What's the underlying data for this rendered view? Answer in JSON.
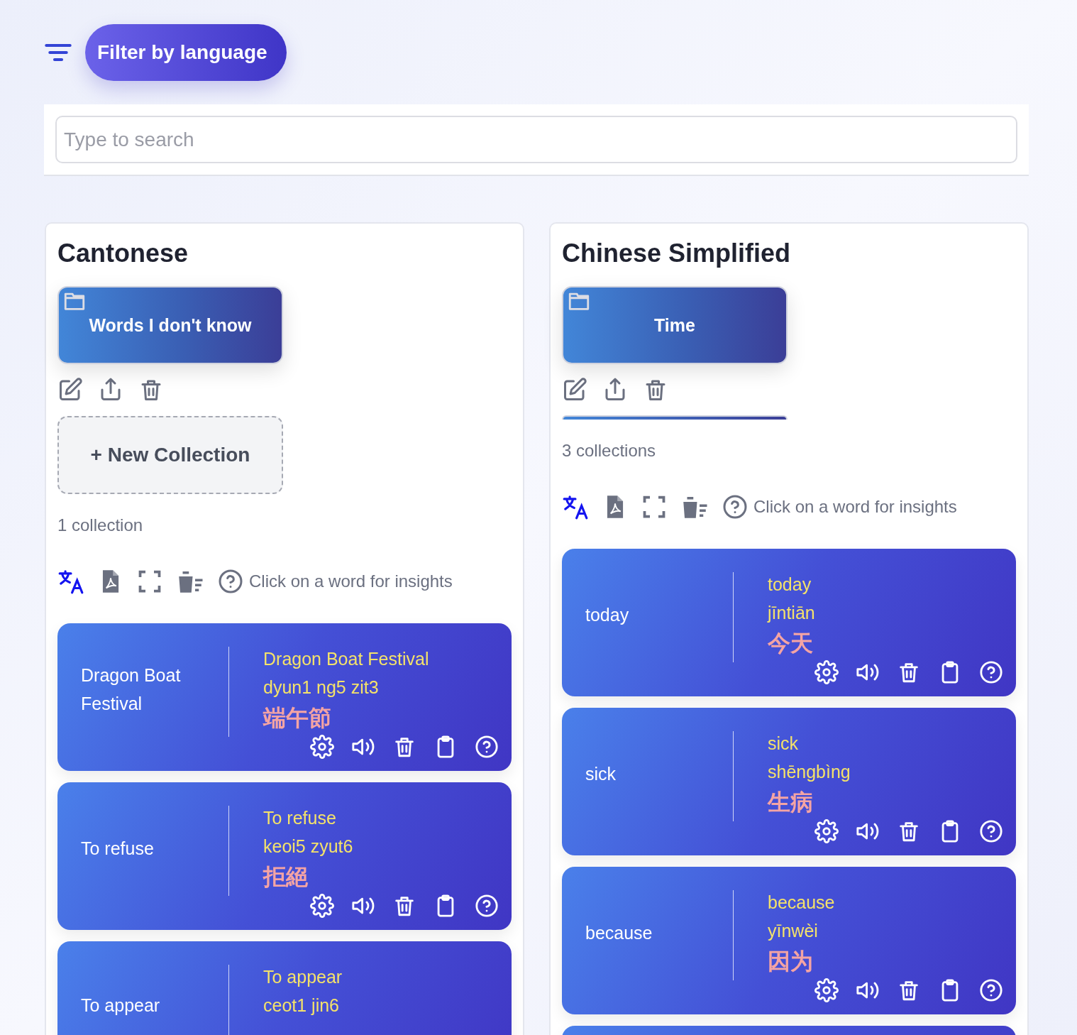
{
  "filter_button": {
    "label": "Filter by language"
  },
  "search": {
    "placeholder": "Type to search"
  },
  "languages": [
    {
      "name": "Cantonese",
      "collections": [
        {
          "kind": "full",
          "name": "Words I don't know"
        }
      ],
      "new_collection": "+ New Collection",
      "collection_count": "1 collection",
      "insights_hint": "Click on a word for insights",
      "words": [
        {
          "kind": "full",
          "term": "Dragon Boat Festival",
          "translation": "Dragon Boat Festival",
          "romanization": "dyun1 ng5 zit3",
          "script": "端午節"
        },
        {
          "kind": "full",
          "term": "To refuse",
          "translation": "To refuse",
          "romanization": "keoi5 zyut6",
          "script": "拒絕"
        },
        {
          "kind": "cut",
          "term": "To appear",
          "translation": "To appear",
          "romanization": "ceot1 jin6"
        }
      ]
    },
    {
      "name": "Chinese Simplified",
      "collections": [
        {
          "kind": "full",
          "name": "Time"
        },
        {
          "kind": "partial"
        }
      ],
      "collection_count": "3 collections",
      "insights_hint": "Click on a word for insights",
      "words": [
        {
          "kind": "full",
          "term": "today",
          "translation": "today",
          "romanization": "jīntiān",
          "script": "今天"
        },
        {
          "kind": "full",
          "term": "sick",
          "translation": "sick",
          "romanization": "shēngbìng",
          "script": "生病"
        },
        {
          "kind": "full",
          "term": "because",
          "translation": "because",
          "romanization": "yīnwèi",
          "script": "因为"
        },
        {
          "kind": "cut"
        }
      ]
    }
  ]
}
